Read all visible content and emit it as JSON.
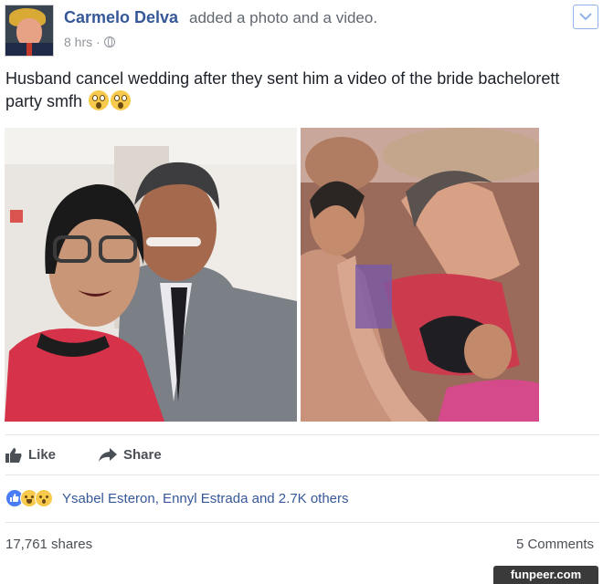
{
  "post": {
    "author": "Carmelo Delva",
    "action": "added a photo and a video.",
    "time": "8 hrs ·",
    "text": "Husband cancel wedding after they sent him a video of the bride bachelorett party smfh"
  },
  "actions": {
    "like_label": "Like",
    "share_label": "Share"
  },
  "reactions": {
    "icons": [
      "like-icon",
      "haha-icon",
      "wow-icon"
    ],
    "names": "Ysabel Esteron, Ennyl Estrada and 2.7K others"
  },
  "stats": {
    "shares": "17,761 shares",
    "comments": "5 Comments"
  },
  "watermark": "funpeer.com",
  "colors": {
    "link_blue": "#365899",
    "meta_gray": "#90949c",
    "like_blue": "#4a7cf6"
  }
}
